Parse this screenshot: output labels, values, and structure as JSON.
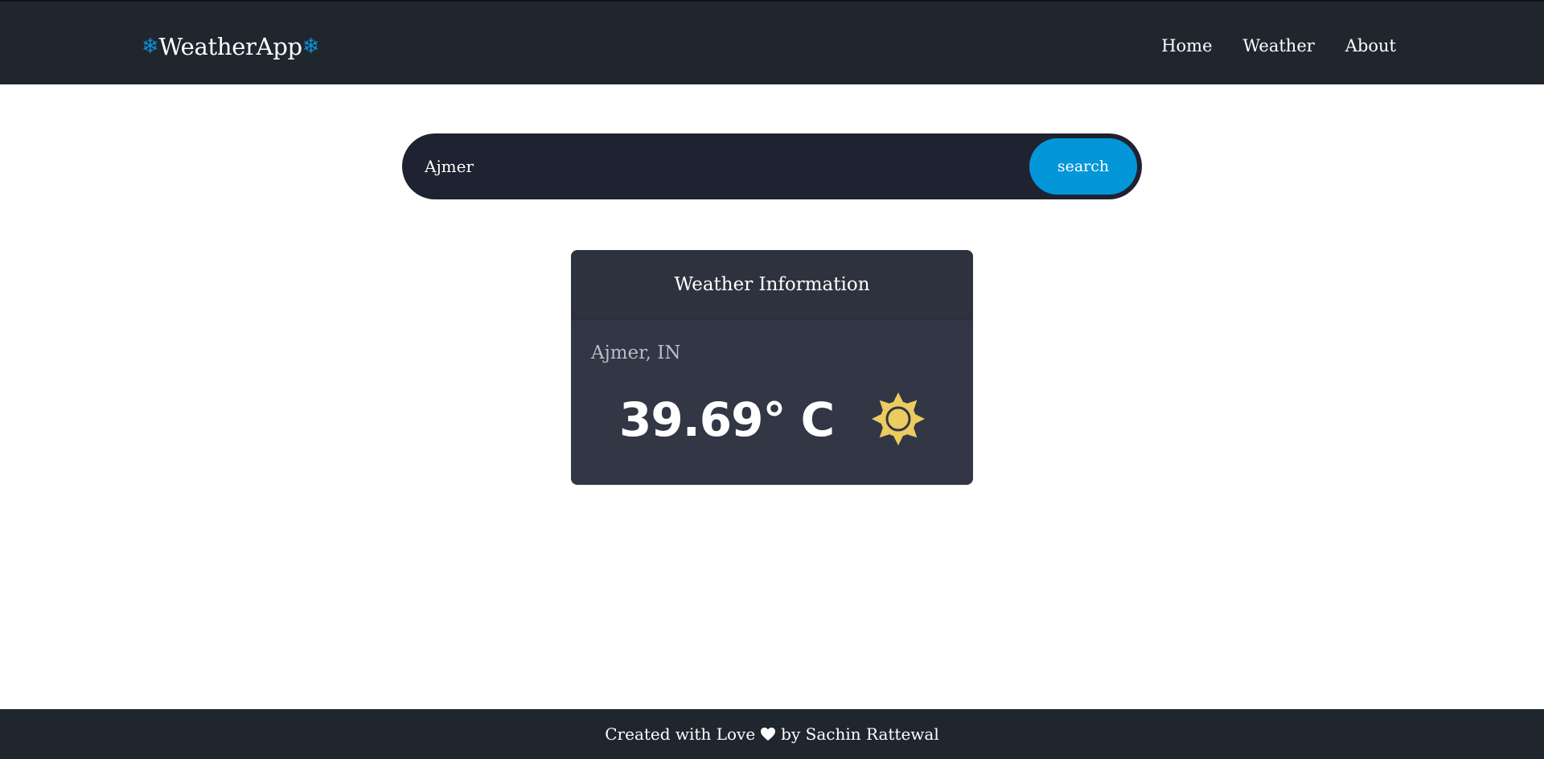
{
  "navbar": {
    "brand": "WeatherApp",
    "brand_icon": "snowflake-icon",
    "brand_icon_color": "#0d90d6",
    "links": [
      {
        "label": "Home"
      },
      {
        "label": "Weather"
      },
      {
        "label": "About"
      }
    ]
  },
  "search": {
    "value": "Ajmer",
    "button_label": "search",
    "button_color": "#0396d9"
  },
  "weather_card": {
    "title": "Weather Information",
    "location": "Ajmer, IN",
    "temperature": "39.69° C",
    "icon": "sun-icon",
    "icon_color": "#eccb60"
  },
  "footer": {
    "prefix": "Created with Love",
    "icon": "heart-icon",
    "suffix": "by Sachin Rattewal"
  }
}
